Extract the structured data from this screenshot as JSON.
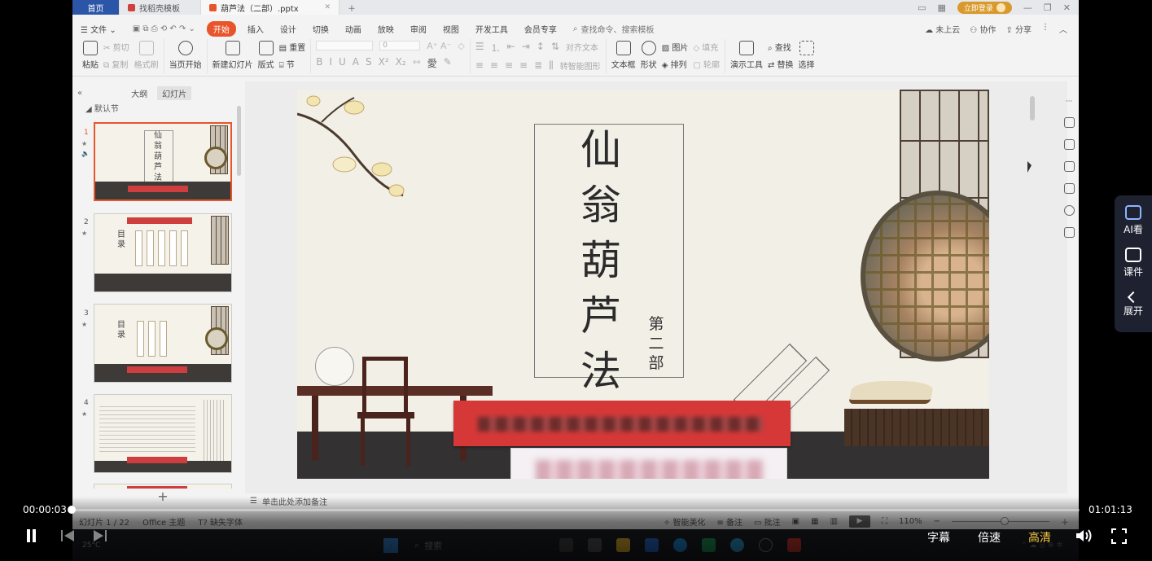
{
  "titlebar": {
    "tabs": [
      {
        "label": "首页"
      },
      {
        "label": "找稻壳模板"
      },
      {
        "label": "葫芦法（二部）.pptx"
      }
    ],
    "login_label": "立即登录"
  },
  "menubar": {
    "file_label": "文件",
    "items": [
      "开始",
      "插入",
      "设计",
      "切换",
      "动画",
      "放映",
      "审阅",
      "视图",
      "开发工具",
      "会员专享"
    ],
    "active_index": 0,
    "search_placeholder": "查找命令、搜索模板",
    "cloud_label": "未上云",
    "collab_label": "协作",
    "share_label": "分享"
  },
  "ribbon": {
    "paste": "粘贴",
    "cut": "剪切",
    "copy": "复制",
    "format_painter": "格式刷",
    "from_current": "当页开始",
    "new_slide": "新建幻灯片",
    "layout": "版式",
    "section": "节",
    "reset": "重置",
    "font_size_value": "0",
    "align_text": "对齐文本",
    "convert_smartart": "转智能图形",
    "textbox": "文本框",
    "shape": "形状",
    "picture": "图片",
    "arrange": "排列",
    "fill": "填充",
    "outline": "轮廓",
    "present_tools": "演示工具",
    "find": "查找",
    "replace": "替换",
    "select": "选择"
  },
  "leftpanel": {
    "tab_outline": "大纲",
    "tab_slides": "幻灯片",
    "section_label": "默认节",
    "slides": [
      {
        "num": "1",
        "title_chars": "仙翁葫芦法"
      },
      {
        "num": "2",
        "mulu": "目录"
      },
      {
        "num": "3",
        "mulu": "目录"
      },
      {
        "num": "4"
      }
    ],
    "add_label": "+"
  },
  "slide": {
    "title": "仙翁葫芦法",
    "subtitle": "第二部"
  },
  "notes": {
    "placeholder": "单击此处添加备注"
  },
  "status": {
    "slide_counter": "幻灯片 1 / 22",
    "theme": "Office 主题",
    "missing_font": "缺失字体",
    "smart_beautify": "智能美化",
    "notes_btn": "备注",
    "comments_btn": "批注",
    "zoom": "110%"
  },
  "taskbar": {
    "weather": "25°C",
    "search_label": "搜索"
  },
  "player": {
    "current_time": "00:00:03",
    "total_time": "01:01:13",
    "progress_fraction": 0.0008,
    "subtitle_btn": "字幕",
    "speed_btn": "倍速",
    "quality_btn": "高清"
  },
  "side_panel": {
    "ai_label": "AI看",
    "courseware_label": "课件",
    "expand_label": "展开"
  },
  "colors": {
    "accent": "#e8542b",
    "banner_red": "#d63838",
    "quality_yellow": "#f5c842"
  }
}
